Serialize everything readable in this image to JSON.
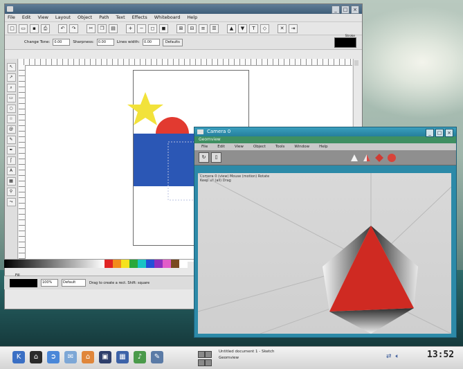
{
  "desktop": {
    "wallpaper": "sky-clouds-sea"
  },
  "sketch": {
    "menu": [
      "File",
      "Edit",
      "View",
      "Layout",
      "Object",
      "Path",
      "Text",
      "Effects",
      "Whiteboard",
      "Help"
    ],
    "options": {
      "label1": "Change Tone:",
      "value1": "0.00",
      "label2": "Sharpness:",
      "value2": "0.00",
      "label3": "Lines width:",
      "value3": "0.00",
      "button": "Defaults",
      "swatch_label": "Stroke"
    },
    "palette": [
      "#e02424",
      "#f28c1c",
      "#f5e21e",
      "#2aa83a",
      "#19c4c4",
      "#2350d8",
      "#8e2fbf",
      "#e25cc9",
      "#7a4a20",
      "#ffffff"
    ],
    "status": {
      "fill_label": "Fill",
      "zoom": "100%",
      "layer": "Default",
      "message": "Drag to create a rect. Shift: square"
    }
  },
  "geomview": {
    "title": "Camera 0",
    "subtitle": "Geomview",
    "menu": [
      "File",
      "Edit",
      "View",
      "Object",
      "Tools",
      "Window",
      "Help"
    ],
    "viewport_text": [
      "Camera 0 (view) Mouse (motion) Rotate",
      "Keep all (all) Drag"
    ]
  },
  "taskbar": {
    "tasks": [
      "Untitled document 1 - Sketch",
      "Geomview"
    ],
    "clock": "13:52",
    "apps": [
      "kde-menu-icon",
      "home-icon",
      "konqueror-icon",
      "mail-icon",
      "file-manager-icon",
      "terminal-icon",
      "calendar-icon",
      "sound-icon",
      "editor-icon"
    ]
  },
  "colors": {
    "sketch_title": "#4a6a88",
    "geom_title": "#2c8aa8",
    "star": "#f2e23a",
    "circle": "#e23a30",
    "rect": "#2b57b5",
    "octa_face": "#cf2a22"
  }
}
